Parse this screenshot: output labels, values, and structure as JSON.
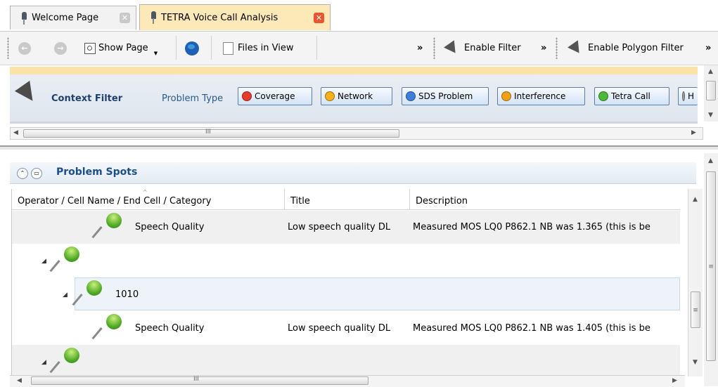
{
  "tabs": [
    {
      "label": "Welcome Page",
      "close": "✕"
    },
    {
      "label": "TETRA Voice Call Analysis",
      "close": "✕"
    }
  ],
  "toolbar": {
    "back_glyph": "←",
    "forward_glyph": "→",
    "show_page": "Show Page",
    "files_in_view": "Files in View",
    "overflow_1": "»",
    "enable_filter": "Enable Filter",
    "overflow_2": "»",
    "enable_polygon_filter": "Enable Polygon Filter",
    "overflow_3": "»"
  },
  "context_filter": {
    "title": "Context Filter",
    "problem_type_label": "Problem Type",
    "chips": [
      {
        "label": "Coverage",
        "color": "#e53b2c"
      },
      {
        "label": "Network",
        "color": "#f3b21b"
      },
      {
        "label": "SDS Problem",
        "color": "#3d7fd6"
      },
      {
        "label": "Interference",
        "color": "#f3a019"
      },
      {
        "label": "Tetra Call",
        "color": "#4db83a"
      },
      {
        "label": "H",
        "color": "#9a9a9a"
      }
    ],
    "hscroll_grip": "III"
  },
  "problem_spots": {
    "title": "Problem Spots",
    "columns": [
      "Operator / Cell Name / End Cell / Category",
      "Title",
      "Description"
    ],
    "rows": [
      {
        "name": "Speech Quality",
        "title": "Low speech quality DL",
        "description": "Measured MOS LQ0 P862.1 NB was 1.365 (this is be"
      },
      {
        "name": "",
        "title": "",
        "description": ""
      },
      {
        "name": "1010",
        "title": "",
        "description": ""
      },
      {
        "name": "Speech Quality",
        "title": "Low speech quality DL",
        "description": "Measured MOS LQ0 P862.1 NB was 1.405 (this is be"
      },
      {
        "name": "",
        "title": "",
        "description": ""
      }
    ],
    "hscroll_grip": "III",
    "vscroll_grip": "≡"
  }
}
